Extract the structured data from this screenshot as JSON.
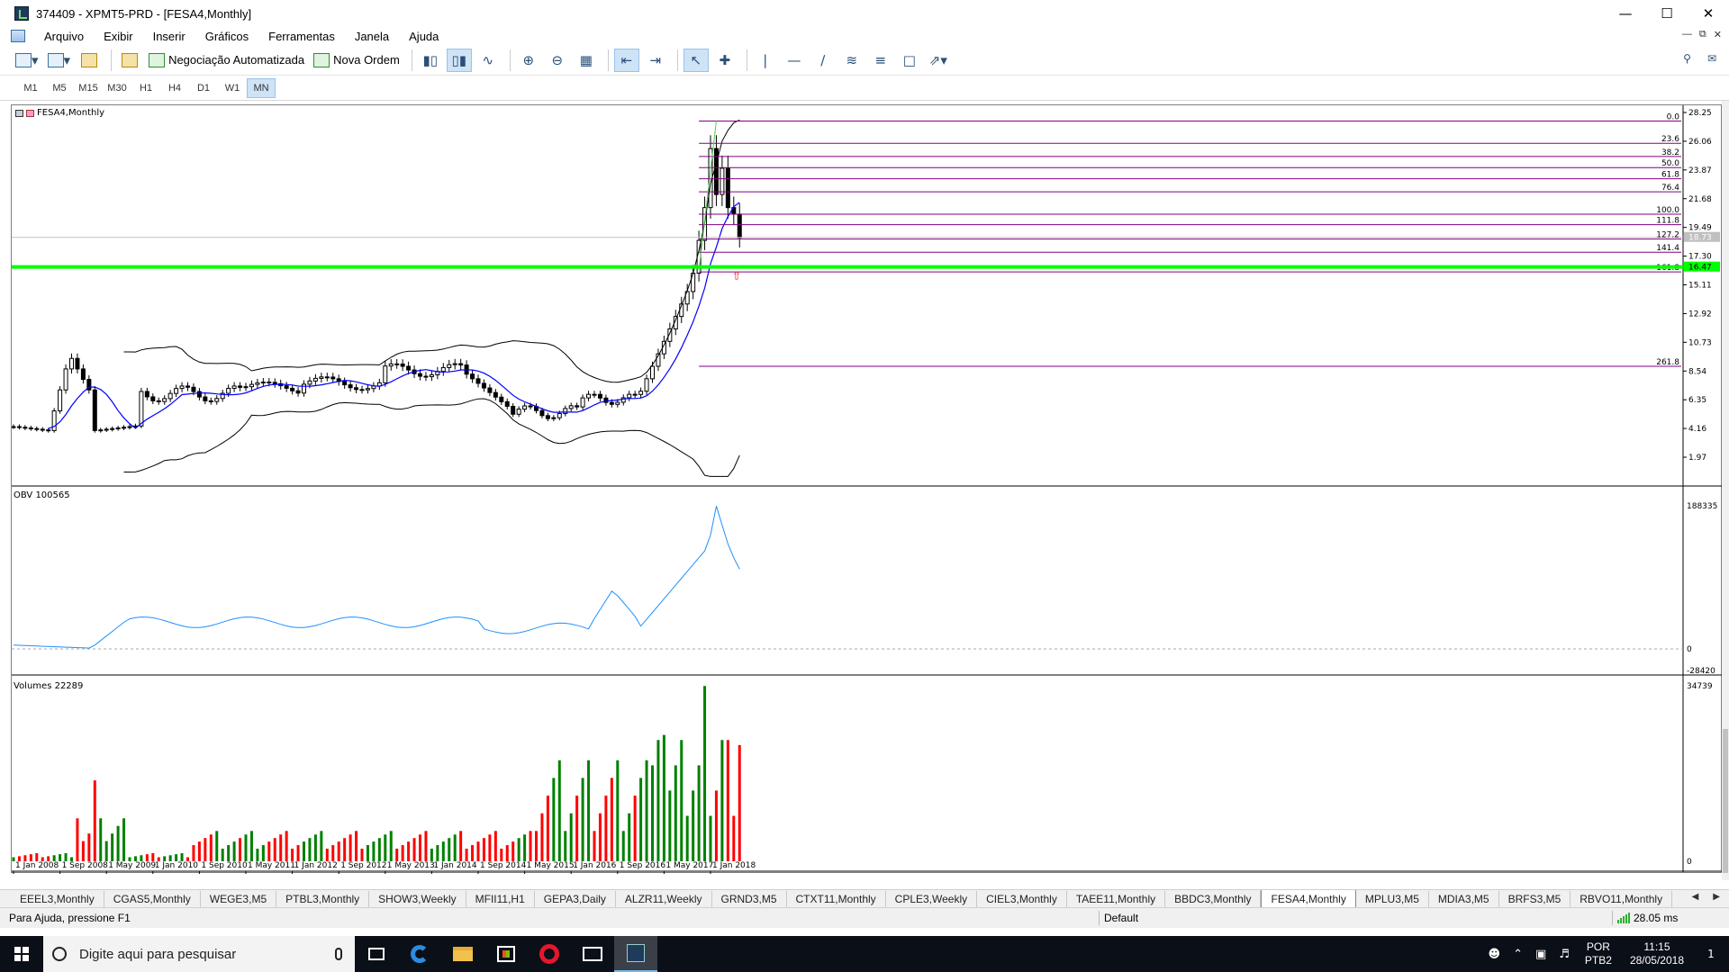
{
  "window": {
    "title": "374409 - XPMT5-PRD - [FESA4,Monthly]"
  },
  "menu": {
    "items": [
      "Arquivo",
      "Exibir",
      "Inserir",
      "Gráficos",
      "Ferramentas",
      "Janela",
      "Ajuda"
    ]
  },
  "toolbar": {
    "algo_label": "Negociação Automatizada",
    "order_label": "Nova Ordem"
  },
  "timeframes": {
    "items": [
      "M1",
      "M5",
      "M15",
      "M30",
      "H1",
      "H4",
      "D1",
      "W1",
      "MN"
    ],
    "active": "MN"
  },
  "chart": {
    "symbol_label": "FESA4,Monthly",
    "obv_label": "OBV 100565",
    "volume_label": "Volumes 22289",
    "price_axis": [
      "28.25",
      "26.06",
      "23.87",
      "21.68",
      "19.49",
      "17.30",
      "15.11",
      "12.92",
      "10.73",
      "8.54",
      "6.35",
      "4.16",
      "1.97"
    ],
    "price_axis_values": [
      28.25,
      26.06,
      23.87,
      21.68,
      19.49,
      17.3,
      15.11,
      12.92,
      10.73,
      8.54,
      6.35,
      4.16,
      1.97
    ],
    "current_price": "18.73",
    "support_price": "16.47",
    "obv_axis": [
      "188335",
      "0",
      "-28420"
    ],
    "volume_axis": [
      "34739",
      "0"
    ],
    "time_axis": [
      "1 Jan 2008",
      "1 Sep 2008",
      "1 May 2009",
      "1 Jan 2010",
      "1 Sep 2010",
      "1 May 2011",
      "1 Jan 2012",
      "1 Sep 2012",
      "1 May 2013",
      "1 Jan 2014",
      "1 Sep 2014",
      "1 May 2015",
      "1 Jan 2016",
      "1 Sep 2016",
      "1 May 2017",
      "1 Jan 2018"
    ],
    "fibo_levels": [
      {
        "label": "0.0",
        "price": 27.6
      },
      {
        "label": "23.6",
        "price": 25.9
      },
      {
        "label": "38.2",
        "price": 24.9
      },
      {
        "label": "50.0",
        "price": 24.05
      },
      {
        "label": "61.8",
        "price": 23.2
      },
      {
        "label": "76.4",
        "price": 22.2
      },
      {
        "label": "100.0",
        "price": 20.5
      },
      {
        "label": "111.8",
        "price": 19.7
      },
      {
        "label": "127.2",
        "price": 18.6
      },
      {
        "label": "141.4",
        "price": 17.6
      },
      {
        "label": "161.8",
        "price": 16.1
      },
      {
        "label": "261.8",
        "price": 8.9
      }
    ],
    "colors": {
      "up": "#000000",
      "down": "#000000",
      "ma": "#0000ff",
      "bands": "#000000",
      "fibo": "#800080",
      "support": "#00ff00",
      "obv": "#1e90ff",
      "vol_up": "#008000",
      "vol_down": "#ff0000"
    }
  },
  "tabs": {
    "items": [
      "EEEL3,Monthly",
      "CGAS5,Monthly",
      "WEGE3,M5",
      "PTBL3,Monthly",
      "SHOW3,Weekly",
      "MFII11,H1",
      "GEPA3,Daily",
      "ALZR11,Weekly",
      "GRND3,M5",
      "CTXT11,Monthly",
      "CPLE3,Weekly",
      "CIEL3,Monthly",
      "TAEE11,Monthly",
      "BBDC3,Monthly",
      "FESA4,Monthly",
      "MPLU3,M5",
      "MDIA3,M5",
      "BRFS3,M5",
      "RBVO11,Monthly"
    ],
    "active": "FESA4,Monthly"
  },
  "status": {
    "help": "Para Ajuda, pressione F1",
    "profile": "Default",
    "ping": "28.05 ms"
  },
  "taskbar": {
    "search_placeholder": "Digite aqui para pesquisar",
    "lang1": "POR",
    "lang2": "PTB2",
    "time": "11:15",
    "date": "28/05/2018",
    "notifications": "1"
  }
}
